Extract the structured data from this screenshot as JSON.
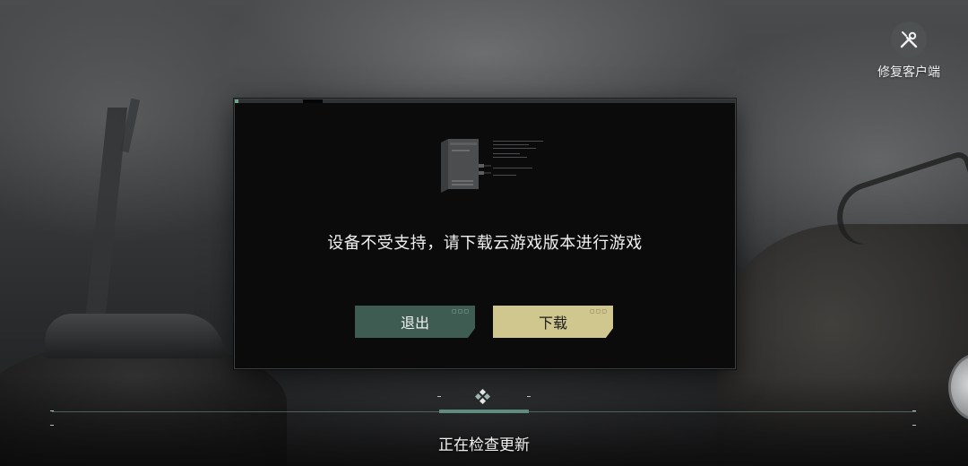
{
  "repair_client": {
    "label": "修复客户端",
    "icon": "wrench-screwdriver-icon"
  },
  "dialog": {
    "message": "设备不受支持，请下载云游戏版本进行游戏",
    "exit_label": "退出",
    "download_label": "下载",
    "exit_color": "#3f5c53",
    "download_color": "#cfc78d",
    "illustration": "server-rack-icon"
  },
  "loading": {
    "status": "正在检查更新",
    "icon": "diamond-loader-icon",
    "accent_color": "#5f8c81"
  }
}
